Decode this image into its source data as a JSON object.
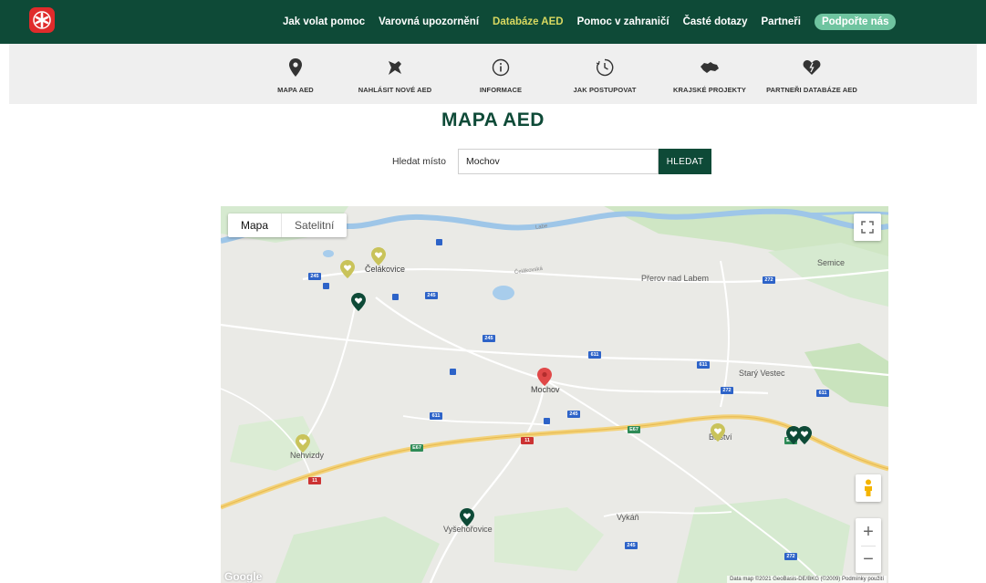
{
  "colors": {
    "brand_green": "#0e4a37",
    "active_nav": "#d8d860",
    "support_badge": "#6fc4a0",
    "logo_red": "#e02b2b",
    "pin_dark": "#0e4a37",
    "pin_yellow": "#c9c35a",
    "pin_red": "#e04848"
  },
  "topnav": {
    "items": [
      "Jak volat pomoc",
      "Varovná upozornění",
      "Databáze AED",
      "Pomoc v zahraničí",
      "Časté dotazy",
      "Partneři"
    ],
    "active_index": 2,
    "support_label": "Podpořte nás"
  },
  "subnav": {
    "items": [
      {
        "label": "MAPA AED",
        "icon": "map-pin-icon"
      },
      {
        "label": "NAHLÁSIT NOVÉ AED",
        "icon": "push-pin-icon"
      },
      {
        "label": "INFORMACE",
        "icon": "info-icon"
      },
      {
        "label": "JAK POSTUPOVAT",
        "icon": "clock-icon"
      },
      {
        "label": "KRAJSKÉ PROJEKTY",
        "icon": "czech-map-icon"
      },
      {
        "label": "PARTNEŘI DATABÁZE AED",
        "icon": "heart-icon"
      }
    ]
  },
  "page_title": "MAPA AED",
  "search": {
    "label": "Hledat místo",
    "value": "Mochov",
    "button": "HLEDAT"
  },
  "map": {
    "type_map": "Mapa",
    "type_satellite": "Satelitní",
    "places": [
      "Čelákovice",
      "Přerov nad Labem",
      "Semice",
      "Starý Vestec",
      "Mochov",
      "Bříství",
      "Nehvizdy",
      "Vyšehořovice",
      "Vykáň"
    ],
    "river_label": "Labe",
    "road_label": "Čelákovská",
    "road_numbers": [
      "245",
      "272",
      "611",
      "E67",
      "11"
    ],
    "attribution": "Data map ©2021 GeoBasis-DE/BKG (©2009)   Podmínky použití",
    "google": "Google"
  }
}
